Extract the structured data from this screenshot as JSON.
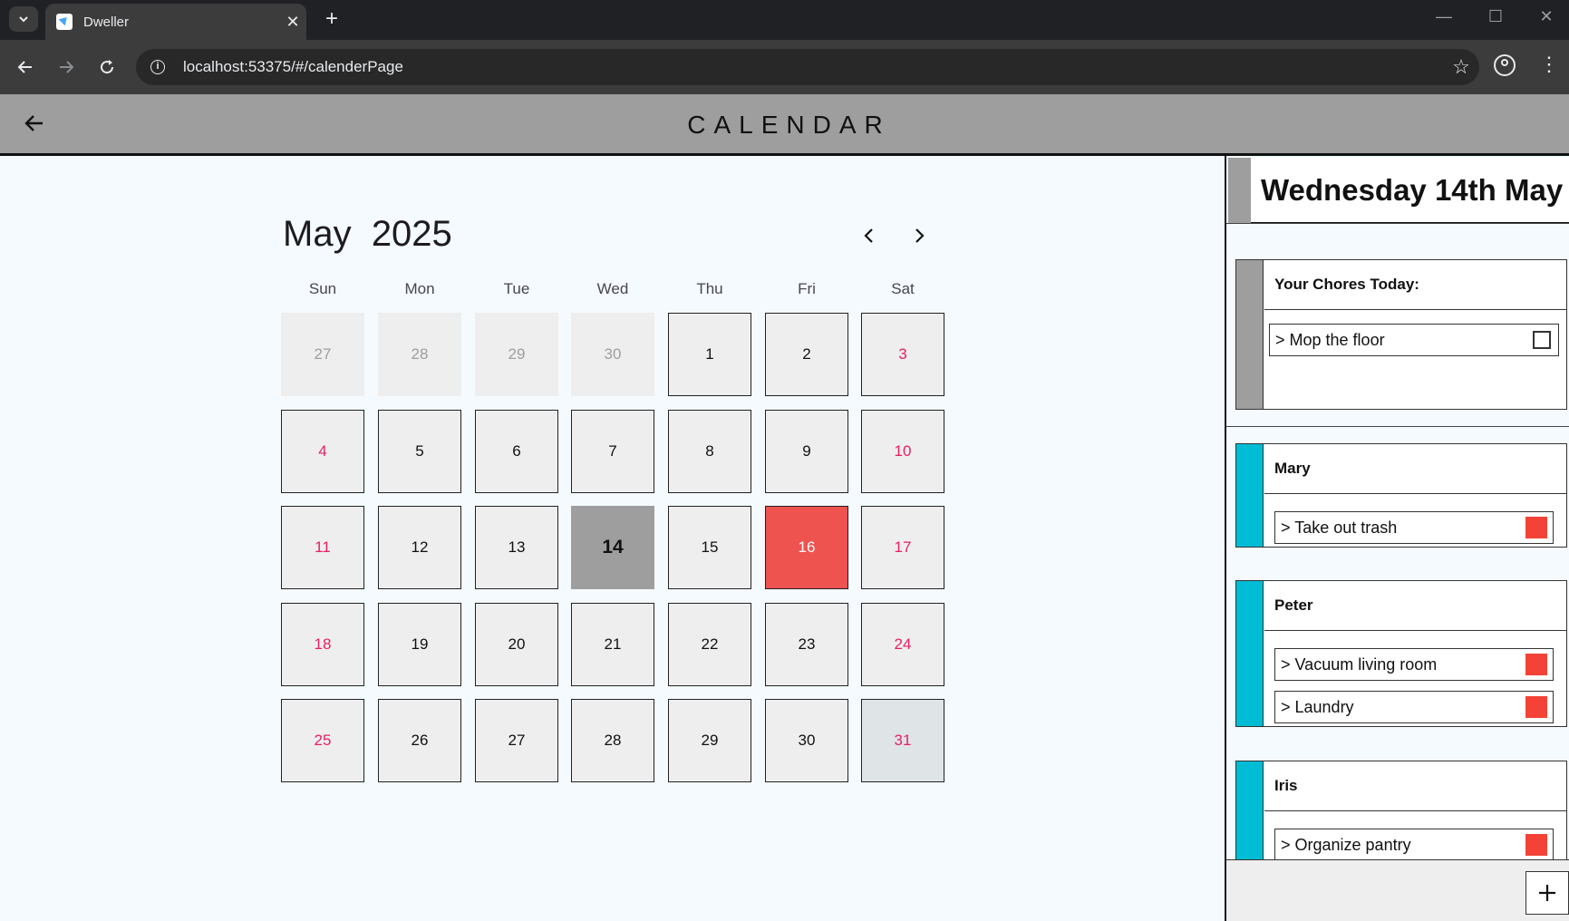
{
  "browser": {
    "tab_title": "Dweller",
    "url": "localhost:53375/#/calenderPage",
    "tab_close": "✕",
    "new_tab": "+",
    "minimize": "—",
    "maximize": "☐",
    "close": "✕"
  },
  "app": {
    "title": "CALENDAR"
  },
  "calendar": {
    "month": "May",
    "year": "2025",
    "weekdays": [
      "Sun",
      "Mon",
      "Tue",
      "Wed",
      "Thu",
      "Fri",
      "Sat"
    ],
    "weeks": [
      [
        "27",
        "28",
        "29",
        "30",
        "1",
        "2",
        "3"
      ],
      [
        "4",
        "5",
        "6",
        "7",
        "8",
        "9",
        "10"
      ],
      [
        "11",
        "12",
        "13",
        "14",
        "15",
        "16",
        "17"
      ],
      [
        "18",
        "19",
        "20",
        "21",
        "22",
        "23",
        "24"
      ],
      [
        "25",
        "26",
        "27",
        "28",
        "29",
        "30",
        "31"
      ]
    ],
    "selected_day": "14",
    "event_day": "16",
    "colors": {
      "weekend": "#e91e63",
      "selected": "#9e9e9e",
      "event": "#ef5350"
    }
  },
  "panel": {
    "date_label": "Wednesday 14th May",
    "my_chores": {
      "title": "Your Chores Today:",
      "items": [
        "> Mop the floor"
      ]
    },
    "people": [
      {
        "name": "Mary",
        "chores": [
          "> Take out trash"
        ]
      },
      {
        "name": "Peter",
        "chores": [
          "> Vacuum living room",
          "> Laundry"
        ]
      },
      {
        "name": "Iris",
        "chores": [
          "> Organize pantry"
        ]
      }
    ],
    "colors": {
      "accent_stripe": "#00bcd4",
      "my_stripe": "#9e9e9e",
      "status": "#f44336"
    },
    "add_label": "+"
  }
}
